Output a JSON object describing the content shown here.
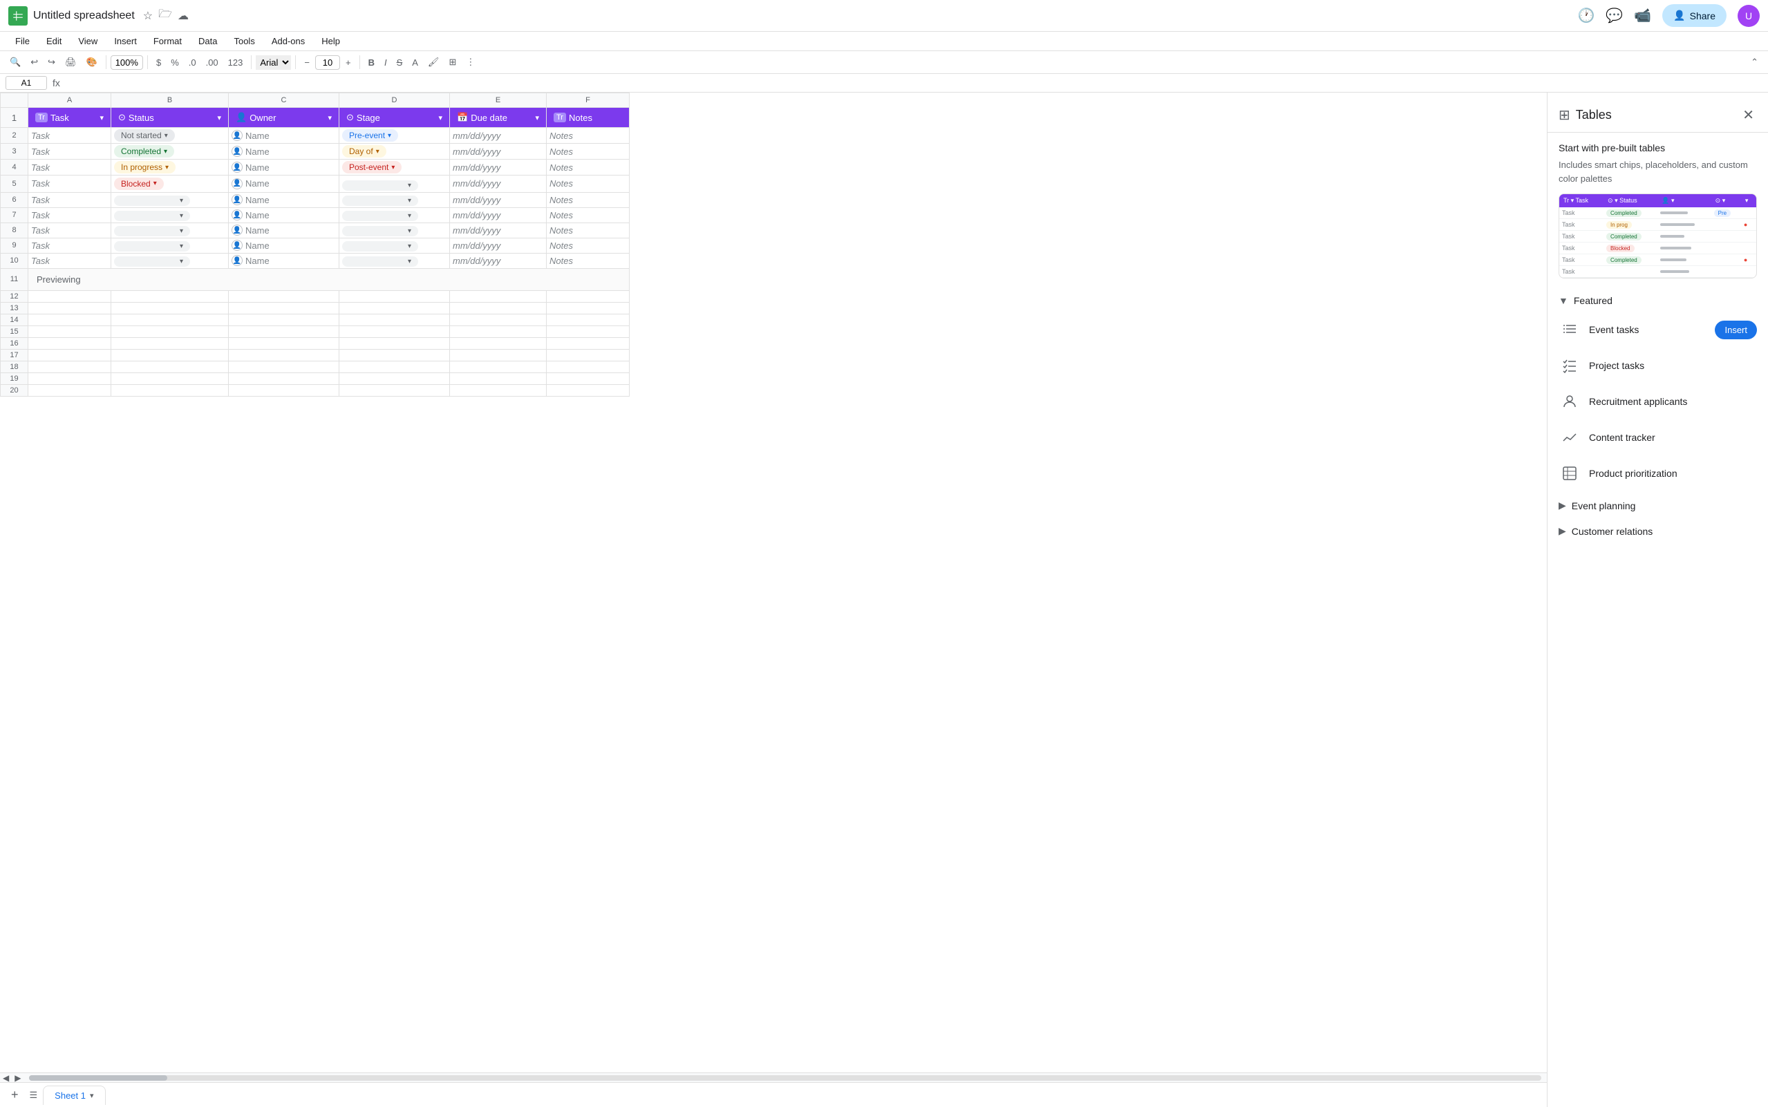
{
  "app": {
    "title": "Untitled spreadsheet",
    "icon_color": "#34a853"
  },
  "menu": {
    "items": [
      "File",
      "Edit",
      "View",
      "Insert",
      "Format",
      "Data",
      "Tools",
      "Add-ons",
      "Help"
    ]
  },
  "toolbar": {
    "zoom": "100%",
    "font": "Arial",
    "font_size": "10"
  },
  "formula_bar": {
    "cell_ref": "A1",
    "formula": ""
  },
  "sheet": {
    "col_headers": [
      "A",
      "B",
      "C",
      "D",
      "E",
      "F"
    ],
    "row_headers": [
      "1",
      "2",
      "3",
      "4",
      "5",
      "6",
      "7",
      "8",
      "9",
      "10",
      "11",
      "12",
      "13",
      "14",
      "15",
      "16",
      "17",
      "18",
      "19",
      "20"
    ],
    "header_cols": [
      {
        "icon": "Tr",
        "label": "Task"
      },
      {
        "icon": "⊙",
        "label": "Status"
      },
      {
        "icon": "👤",
        "label": "Owner"
      },
      {
        "icon": "⊙",
        "label": "Stage"
      },
      {
        "icon": "📅",
        "label": "Due date"
      },
      {
        "icon": "Tr",
        "label": "Notes"
      }
    ],
    "rows": [
      {
        "task": "Task",
        "status": "Not started",
        "status_type": "not-started",
        "owner": "Name",
        "stage": "Pre-event",
        "stage_type": "pre",
        "date": "mm/dd/yyyy",
        "notes": "Notes"
      },
      {
        "task": "Task",
        "status": "Completed",
        "status_type": "completed",
        "owner": "Name",
        "stage": "Day of",
        "stage_type": "day",
        "date": "mm/dd/yyyy",
        "notes": "Notes"
      },
      {
        "task": "Task",
        "status": "In progress",
        "status_type": "in-progress",
        "owner": "Name",
        "stage": "Post-event",
        "stage_type": "post",
        "date": "mm/dd/yyyy",
        "notes": "Notes"
      },
      {
        "task": "Task",
        "status": "Blocked",
        "status_type": "blocked",
        "owner": "Name",
        "stage": "",
        "stage_type": "empty",
        "date": "mm/dd/yyyy",
        "notes": "Notes"
      },
      {
        "task": "Task",
        "status": "",
        "status_type": "empty",
        "owner": "Name",
        "stage": "",
        "stage_type": "empty",
        "date": "mm/dd/yyyy",
        "notes": "Notes"
      },
      {
        "task": "Task",
        "status": "",
        "status_type": "empty",
        "owner": "Name",
        "stage": "",
        "stage_type": "empty",
        "date": "mm/dd/yyyy",
        "notes": "Notes"
      },
      {
        "task": "Task",
        "status": "",
        "status_type": "empty",
        "owner": "Name",
        "stage": "",
        "stage_type": "empty",
        "date": "mm/dd/yyyy",
        "notes": "Notes"
      },
      {
        "task": "Task",
        "status": "",
        "status_type": "empty",
        "owner": "Name",
        "stage": "",
        "stage_type": "empty",
        "date": "mm/dd/yyyy",
        "notes": "Notes"
      },
      {
        "task": "Task",
        "status": "",
        "status_type": "empty",
        "owner": "Name",
        "stage": "",
        "stage_type": "empty",
        "date": "mm/dd/yyyy",
        "notes": "Notes"
      }
    ],
    "preview_label": "Previewing",
    "tab_name": "Sheet 1"
  },
  "panel": {
    "title": "Tables",
    "description": "Start with pre-built tables",
    "subdesc": "Includes smart chips, placeholders, and custom color palettes",
    "featured_label": "Featured",
    "items": [
      {
        "icon": "checklist",
        "label": "Event tasks",
        "has_insert": true
      },
      {
        "icon": "checklist2",
        "label": "Project tasks",
        "has_insert": false
      },
      {
        "icon": "person",
        "label": "Recruitment applicants",
        "has_insert": false
      },
      {
        "icon": "trending",
        "label": "Content tracker",
        "has_insert": false
      },
      {
        "icon": "table",
        "label": "Product prioritization",
        "has_insert": false
      }
    ],
    "insert_label": "Insert",
    "event_planning_label": "Event planning",
    "customer_relations_label": "Customer relations"
  }
}
